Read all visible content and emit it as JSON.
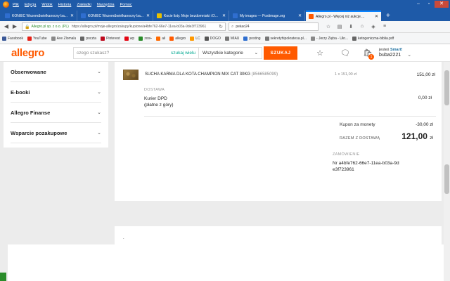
{
  "browser": {
    "menu": [
      "Plik",
      "Edycja",
      "Widok",
      "Historia",
      "Zakładki",
      "Narzędzia",
      "Pomoc"
    ],
    "tabs": [
      {
        "title": "KONIEC Wszem&wielkanocny ba...",
        "color": "#2f6ecf",
        "active": false
      },
      {
        "title": "KONIEC Wszem&wielkanocny ba...",
        "color": "#2f6ecf",
        "active": false
      },
      {
        "title": "Kocie listy. Moje bezdomniaki i D...",
        "color": "#e8c000",
        "active": false
      },
      {
        "title": "My images — Postimage.org",
        "color": "#2f6ecf",
        "active": false
      },
      {
        "title": "Allegro.pl - Więcej niż aukcje....",
        "color": "#ff5a00",
        "active": true
      }
    ],
    "url_owner": "Allegro.pl sp. z o.o. (PL)",
    "url": "https://allegro.pl/moje-allegro/zakupy/kupione/a4bfe762-66e7-11ea-b03a-9de3f723961",
    "search_value": "pekao24",
    "bookmarks": [
      {
        "label": "Facebook",
        "color": "#3b5998"
      },
      {
        "label": "YouTube",
        "color": "#e62117"
      },
      {
        "label": "Ave Zlomalu",
        "color": "#888888"
      },
      {
        "label": "poczta",
        "color": "#666666"
      },
      {
        "label": "Pinterest",
        "color": "#bd081c"
      },
      {
        "label": "wp",
        "color": "#e30613"
      },
      {
        "label": "zoo+",
        "color": "#2a8c2a"
      },
      {
        "label": "ali",
        "color": "#ff6a00"
      },
      {
        "label": "allegro",
        "color": "#ff5a00"
      },
      {
        "label": "LC",
        "color": "#ff9900"
      },
      {
        "label": "DOGO",
        "color": "#555555"
      },
      {
        "label": "MIAU",
        "color": "#777777"
      },
      {
        "label": "posting",
        "color": "#2f6ecf"
      },
      {
        "label": "sekretyhipokratesa.pl...",
        "color": "#777777"
      },
      {
        "label": "- Jerzy Zięba - Ukr...",
        "color": "#888888"
      },
      {
        "label": "ketogeniczna-biblia.pdf",
        "color": "#666666"
      }
    ]
  },
  "header": {
    "logo": "allegro",
    "search_placeholder": "czego szukasz?",
    "search_wide": "szukaj wielu",
    "category": "Wszystkie kategorie",
    "search_button": "SZUKAJ",
    "cart_count": "1",
    "smart_prefix": "jesteś",
    "smart_label": "Smart!",
    "username": "buba2221"
  },
  "sidebar": {
    "items": [
      "Obserwowane",
      "E-booki",
      "Allegro Finanse",
      "Wsparcie pozakupowe"
    ]
  },
  "order": {
    "product_name": "SUCHA KARMA DLA KOTA CHAMPION MIX CAT 30KG",
    "product_id": "(8566585099)",
    "qty": "1 x 151,00 zł",
    "price": "151,00 zł",
    "shipping_label": "DOSTAWA",
    "shipping_name": "Kurier DPD",
    "shipping_note": "(płatne z góry)",
    "shipping_price": "0,00 zł",
    "coupon_label": "Kupon za monety",
    "coupon_value": "-30,00 zł",
    "total_label": "RAZEM Z DOSTAWĄ",
    "total_amount": "121,00",
    "total_currency": "zł",
    "order_label": "ZAMÓWIENIE",
    "order_number": "Nr a4bfe762-66e7-11ea-b03a-9de3f723961"
  },
  "colors": {
    "brand": "#ff5a00",
    "firefox_bar": "#1e5aa8",
    "link_green": "#00a790"
  }
}
